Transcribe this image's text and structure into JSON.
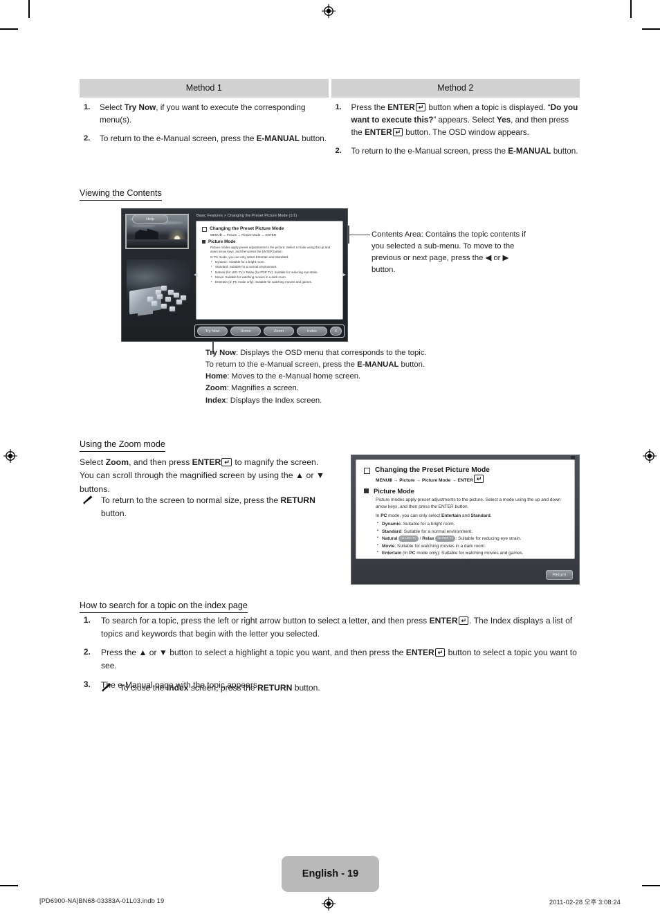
{
  "methods": {
    "header": [
      "Method 1",
      "Method 2"
    ],
    "col1": [
      {
        "num": "1.",
        "html": "Select <b>Try Now</b>, if you want to execute the corresponding menu(s)."
      },
      {
        "num": "2.",
        "html": "To return to the e-Manual screen, press the <b>E-MANUAL</b> button."
      }
    ],
    "col2": [
      {
        "num": "1.",
        "html": "Press the <b>ENTER</b><span class=\"enter\"></span> button when a topic is displayed. “<b>Do you want to execute this?</b>” appears. Select <b>Yes</b>, and then press the <b>ENTER</b><span class=\"enter\"></span> button. The OSD window appears."
      },
      {
        "num": "2.",
        "html": "To return to the e-Manual screen, press the <b>E-MANUAL</b> button."
      }
    ]
  },
  "viewing": {
    "heading": "Viewing the Contents",
    "tv": {
      "breadcrumb": "Basic Features > Changing the Preset Picture Mode (1/1)",
      "title": "Changing the Preset Picture Mode",
      "path": "MENUⅢ → Picture → Picture Mode → ENTER",
      "subtitle": "Picture Mode",
      "body": "Picture modes apply preset adjustments to the picture. Select a mode using the up and down arrow keys, and then press the ENTER button.",
      "note": "In PC mode, you can only select Entertain and Standard.",
      "items": [
        "Dynamic: Suitable for a bright room.",
        "Standard: Suitable for a normal environment.",
        "Natural (for LED TV) / Relax (for PDP TV): Suitable for reducing eye strain.",
        "Movie: Suitable for watching movies in a dark room.",
        "Entertain (In PC mode only): Suitable for watching movies and games."
      ],
      "help_button": "Help",
      "buttons": [
        "Try Now",
        "Home",
        "Zoom",
        "Index",
        "X"
      ]
    },
    "callout_right": "Contents Area: Contains the topic contents if you selected a sub-menu. To move to the previous or next page, press the ◀ or ▶ button.",
    "callout_bottom_html": "<b>Try Now</b>: Displays the OSD menu that corresponds to the topic. To return to the e-Manual screen, press the <b>E-MANUAL</b> button.<br><b>Home</b>: Moves to the e-Manual home screen.<br><b>Zoom</b>: Magnifies a screen.<br><b>Index</b>: Displays the Index screen."
  },
  "zoom_mode": {
    "heading": "Using the Zoom mode",
    "body_html": "Select <b>Zoom</b>, and then press <b>ENTER</b><span class=\"enter\"></span> to magnify the screen. You can scroll through the magnified screen by using the ▲ or ▼ buttons.",
    "note_html": "To return to the screen to normal size, press the <b>RETURN</b> button.",
    "osd": {
      "title": "Changing the Preset Picture Mode",
      "path_menu": "MENUⅢ",
      "path_rest": " → Picture → Picture Mode → ",
      "path_enter": "ENTER",
      "subtitle": "Picture Mode",
      "body": "Picture modes apply preset adjustments to the picture. Select a mode using the up and down arrow keys, and then press the ENTER button.",
      "note_html": "In <b>PC</b> mode, you can only select <b>Entertain</b> and <b>Standard</b>.",
      "items_html": [
        "<b>Dynamic</b>: Suitable for a bright room.",
        "<b>Standard</b>: Suitable for a normal environment.",
        "<b>Natural</b> <span class=\"badge2\">for LED TV</span> / <b>Relax</b> <span class=\"badge2\">for PDP TV</span>: Suitable for reducing eye strain.",
        "<b>Movie</b>: Suitable for watching movies in a dark room.",
        "<b>Entertain</b> (In <b>PC</b> mode only): Suitable for watching movies and games."
      ],
      "down_arrow": "▼",
      "return_button": "Return"
    }
  },
  "index_search": {
    "heading": "How to search for a topic on the index page",
    "steps": [
      {
        "num": "1.",
        "html": "To search for a topic, press the left or right arrow button to select a letter, and then press <b>ENTER</b><span class=\"enter\"></span>. The Index displays a list of topics and keywords that begin with the letter you selected."
      },
      {
        "num": "2.",
        "html": "Press the ▲ or ▼ button to select a highlight a topic you want, and then press the <b>ENTER</b><span class=\"enter\"></span> button to select a topic you want to see."
      },
      {
        "num": "3.",
        "html": "The e-Manual page with the topic appears."
      }
    ],
    "note_html": "To close the <b>Index</b> screen, press the <b>RETURN</b> button."
  },
  "footer": {
    "page_label": "English - 19",
    "file_ref": "[PD6900-NA]BN68-03383A-01L03.indb   19",
    "timestamp": "2011-02-28   오후 3:08:24"
  }
}
